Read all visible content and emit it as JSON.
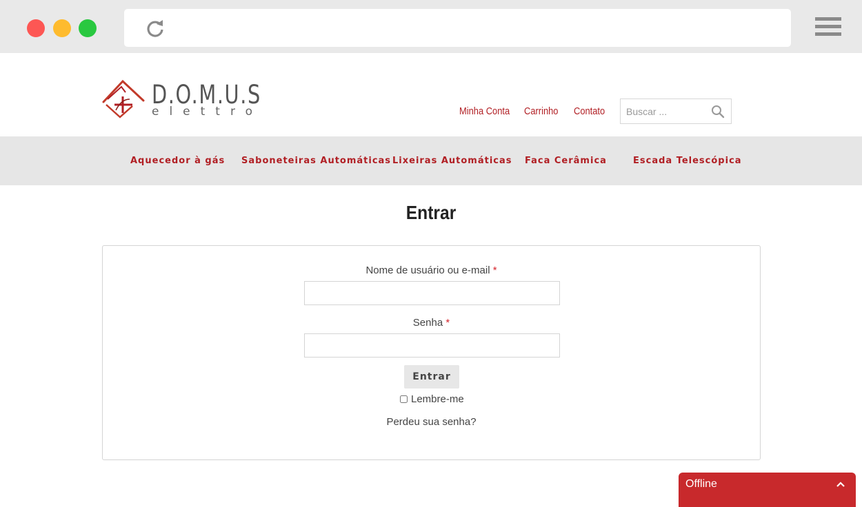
{
  "browser": {
    "dots": [
      "#fd5754",
      "#febb2e",
      "#29c840"
    ],
    "reload_icon": "reload-icon",
    "menu_icon": "hamburger-icon"
  },
  "header": {
    "logo": {
      "name": "D.O.M.U.S",
      "sub": "elettro",
      "icon": "house-logo-icon",
      "color": "#b11f24"
    },
    "links": [
      "Minha Conta",
      "Carrinho",
      "Contato"
    ],
    "search": {
      "placeholder": "Buscar ...",
      "icon": "search-icon"
    }
  },
  "nav": {
    "items": [
      "Aquecedor à gás",
      "Saboneteiras Automáticas",
      "Lixeiras Automáticas",
      "Faca Cerâmica",
      "Escada Telescópica"
    ]
  },
  "main": {
    "title": "Entrar",
    "username_label": "Nome de usuário ou e-mail",
    "password_label": "Senha",
    "required_mark": "*",
    "submit_label": "Entrar",
    "remember_label": "Lembre-me",
    "lost_password": "Perdeu sua senha?"
  },
  "chat": {
    "label": "Offline",
    "icon": "chevron-up-icon"
  },
  "colors": {
    "accent": "#b11f24",
    "chat_bg": "#c8292c",
    "nav_bg": "#e6e6e6",
    "chrome_bg": "#e9e9e9"
  }
}
